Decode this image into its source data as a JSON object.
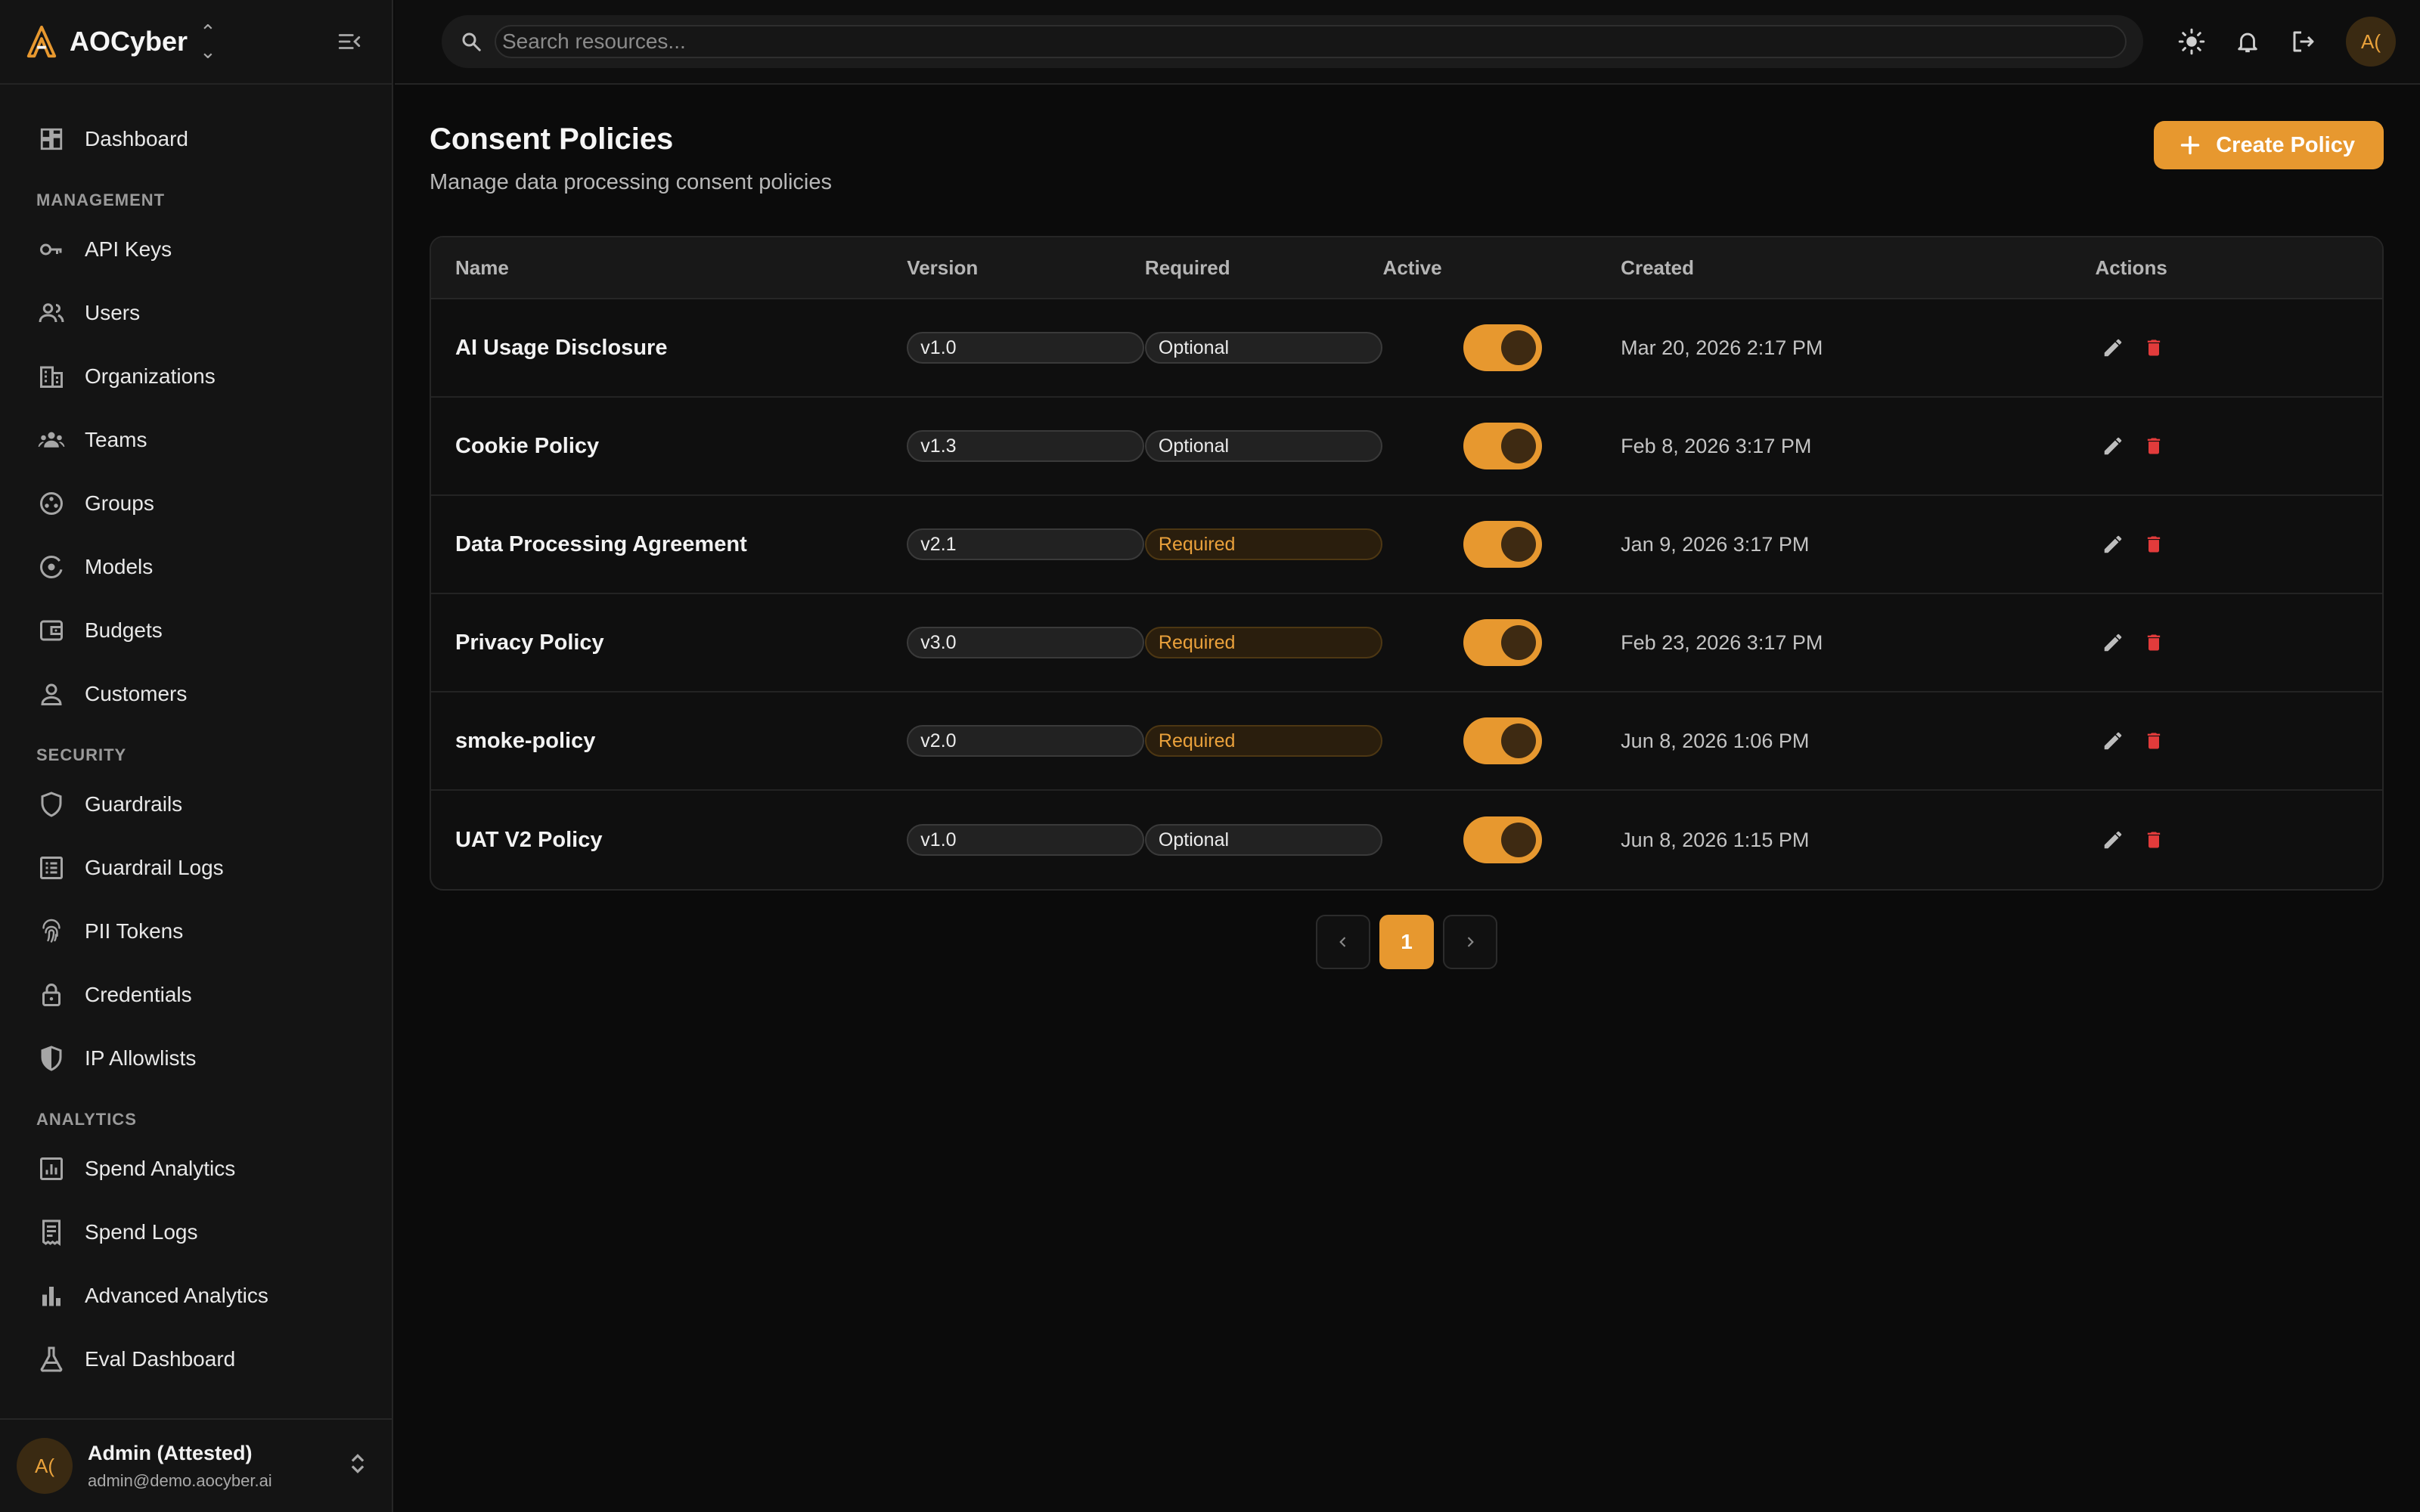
{
  "app": {
    "brand": "AOCyber"
  },
  "sidebar": {
    "top_items": [
      {
        "label": "Dashboard",
        "icon": "dashboard-icon"
      }
    ],
    "sections": [
      {
        "title": "MANAGEMENT",
        "items": [
          {
            "label": "API Keys",
            "icon": "key-icon"
          },
          {
            "label": "Users",
            "icon": "users-icon"
          },
          {
            "label": "Organizations",
            "icon": "building-icon"
          },
          {
            "label": "Teams",
            "icon": "teams-icon"
          },
          {
            "label": "Groups",
            "icon": "groups-icon"
          },
          {
            "label": "Models",
            "icon": "models-icon"
          },
          {
            "label": "Budgets",
            "icon": "wallet-icon"
          },
          {
            "label": "Customers",
            "icon": "person-icon"
          }
        ]
      },
      {
        "title": "SECURITY",
        "items": [
          {
            "label": "Guardrails",
            "icon": "shield-icon"
          },
          {
            "label": "Guardrail Logs",
            "icon": "log-list-icon"
          },
          {
            "label": "PII Tokens",
            "icon": "fingerprint-icon"
          },
          {
            "label": "Credentials",
            "icon": "lock-icon"
          },
          {
            "label": "IP Allowlists",
            "icon": "shield-half-icon"
          }
        ]
      },
      {
        "title": "ANALYTICS",
        "items": [
          {
            "label": "Spend Analytics",
            "icon": "analytics-icon"
          },
          {
            "label": "Spend Logs",
            "icon": "receipt-icon"
          },
          {
            "label": "Advanced Analytics",
            "icon": "bar-chart-icon"
          },
          {
            "label": "Eval Dashboard",
            "icon": "flask-icon"
          }
        ]
      }
    ],
    "user": {
      "initials": "A(",
      "name": "Admin (Attested)",
      "email": "admin@demo.aocyber.ai"
    }
  },
  "topbar": {
    "search_placeholder": "Search resources...",
    "avatar_initials": "A("
  },
  "page": {
    "title": "Consent Policies",
    "subtitle": "Manage data processing consent policies",
    "create_button": "Create Policy"
  },
  "table": {
    "columns": [
      "Name",
      "Version",
      "Required",
      "Active",
      "Created",
      "Actions"
    ],
    "rows": [
      {
        "name": "AI Usage Disclosure",
        "version": "v1.0",
        "required": "Optional",
        "is_required": false,
        "active": true,
        "created": "Mar 20, 2026 2:17 PM"
      },
      {
        "name": "Cookie Policy",
        "version": "v1.3",
        "required": "Optional",
        "is_required": false,
        "active": true,
        "created": "Feb 8, 2026 3:17 PM"
      },
      {
        "name": "Data Processing Agreement",
        "version": "v2.1",
        "required": "Required",
        "is_required": true,
        "active": true,
        "created": "Jan 9, 2026 3:17 PM"
      },
      {
        "name": "Privacy Policy",
        "version": "v3.0",
        "required": "Required",
        "is_required": true,
        "active": true,
        "created": "Feb 23, 2026 3:17 PM"
      },
      {
        "name": "smoke-policy",
        "version": "v2.0",
        "required": "Required",
        "is_required": true,
        "active": true,
        "created": "Jun 8, 2026 1:06 PM"
      },
      {
        "name": "UAT V2 Policy",
        "version": "v1.0",
        "required": "Optional",
        "is_required": false,
        "active": true,
        "created": "Jun 8, 2026 1:15 PM"
      }
    ]
  },
  "pagination": {
    "current_page": "1"
  },
  "colors": {
    "accent": "#e7982f",
    "danger": "#e23b3b",
    "background": "#0b0b0b",
    "sidebar": "#141414"
  }
}
